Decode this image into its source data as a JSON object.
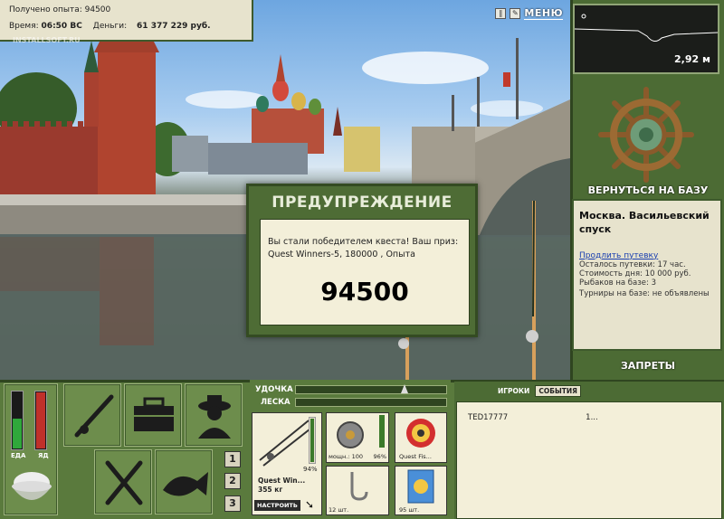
{
  "stats": {
    "xp_label": "Получено опыта:",
    "xp_value": "94500",
    "time_label": "Время:",
    "time_value": "06:50 ВС",
    "money_label": "Деньги:",
    "money_value": "61 377 229 руб."
  },
  "watermark": "INSTALLSOFT.RU",
  "top_menu": {
    "pause_icon": "pause-icon",
    "settings_icon": "wrench-icon",
    "menu_label": "МЕНЮ"
  },
  "depth": {
    "value": "2,92 м"
  },
  "right_panel": {
    "home_button": "ВЕРНУТЬСЯ НА БАЗУ",
    "location_title": "Москва. Васильевский спуск",
    "extend_link": "Продлить путевку",
    "lines": [
      "Осталось путевки: 17 час.",
      "Стоимость дня: 10 000 руб.",
      "Рыбаков на базе: 3",
      "Турниры на базе: не объявлены"
    ],
    "bans_button": "ЗАПРЕТЫ"
  },
  "dialog": {
    "title": "ПРЕДУПРЕЖДЕНИЕ",
    "message": "Вы стали победителем квеста! Ваш приз: Quest Winners-5, 180000 , Опыта",
    "value": "94500"
  },
  "bottom_left": {
    "food_label": "ЕДА",
    "poison_label": "ЯД",
    "food_level": 0.55,
    "poison_level": 1.0,
    "page_buttons": [
      "1",
      "2",
      "3"
    ]
  },
  "tackle": {
    "rod_label": "УДОЧКА",
    "line_label": "ЛЕСКА",
    "rod_name": "Quest Win...",
    "rod_weight": "355 кг",
    "rod_percent": "94%",
    "setup_button": "НАСТРОИТЬ",
    "reel_power": "мощн.: 100",
    "reel_percent": "96%",
    "line_name": "Quest Fis...",
    "hook_count": "12 шт.",
    "bait_count": "95 шт."
  },
  "chat": {
    "tab_players": "ИГРОКИ",
    "tab_events": "СОБЫТИЯ",
    "rows": [
      {
        "name": "TED17777",
        "value": "1..."
      }
    ]
  },
  "colors": {
    "panel_green": "#4c6b34",
    "cream": "#f3efd9"
  }
}
